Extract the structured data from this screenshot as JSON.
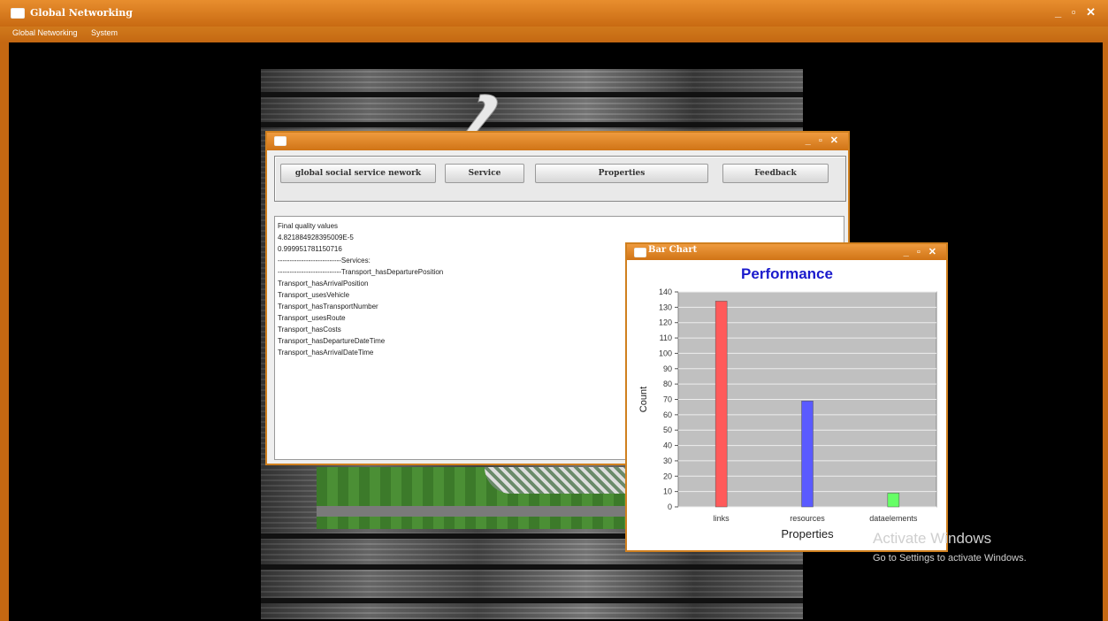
{
  "app": {
    "title": "Global Networking",
    "menu": [
      "Global Networking",
      "System"
    ],
    "window_controls": "_ ▫ ✕"
  },
  "internal_window": {
    "controls": "_ ▫ ✕",
    "buttons": [
      {
        "label": "global social service nework"
      },
      {
        "label": "Service"
      },
      {
        "label": "Properties"
      },
      {
        "label": "Feedback"
      }
    ],
    "output_lines": [
      "Final quality values",
      "4.821884928395009E-5",
      "0.999951781150716",
      "---------------------------Services:",
      "---------------------------Transport_hasDeparturePosition",
      "Transport_hasArrivalPosition",
      "Transport_usesVehicle",
      "Transport_hasTransportNumber",
      "Transport_usesRoute",
      "Transport_hasCosts",
      "Transport_hasDepartureDateTime",
      "Transport_hasArrivalDateTime"
    ]
  },
  "chart_window": {
    "title": "Bar Chart",
    "controls": "_ ▫ ✕"
  },
  "chart_data": {
    "type": "bar",
    "title": "Performance",
    "xlabel": "Properties",
    "ylabel": "Count",
    "categories": [
      "links",
      "resources",
      "dataelements"
    ],
    "values": [
      134,
      69,
      9
    ],
    "colors": [
      "#ff5a5a",
      "#5a5aff",
      "#66ff66"
    ],
    "ylim": [
      0,
      140
    ],
    "yticks": [
      0,
      10,
      20,
      30,
      40,
      50,
      60,
      70,
      80,
      90,
      100,
      110,
      120,
      130,
      140
    ],
    "grid": true,
    "plot_background": "#c0c0c0"
  },
  "watermark": {
    "line1": "Activate Windows",
    "line2": "Go to Settings to activate Windows."
  }
}
